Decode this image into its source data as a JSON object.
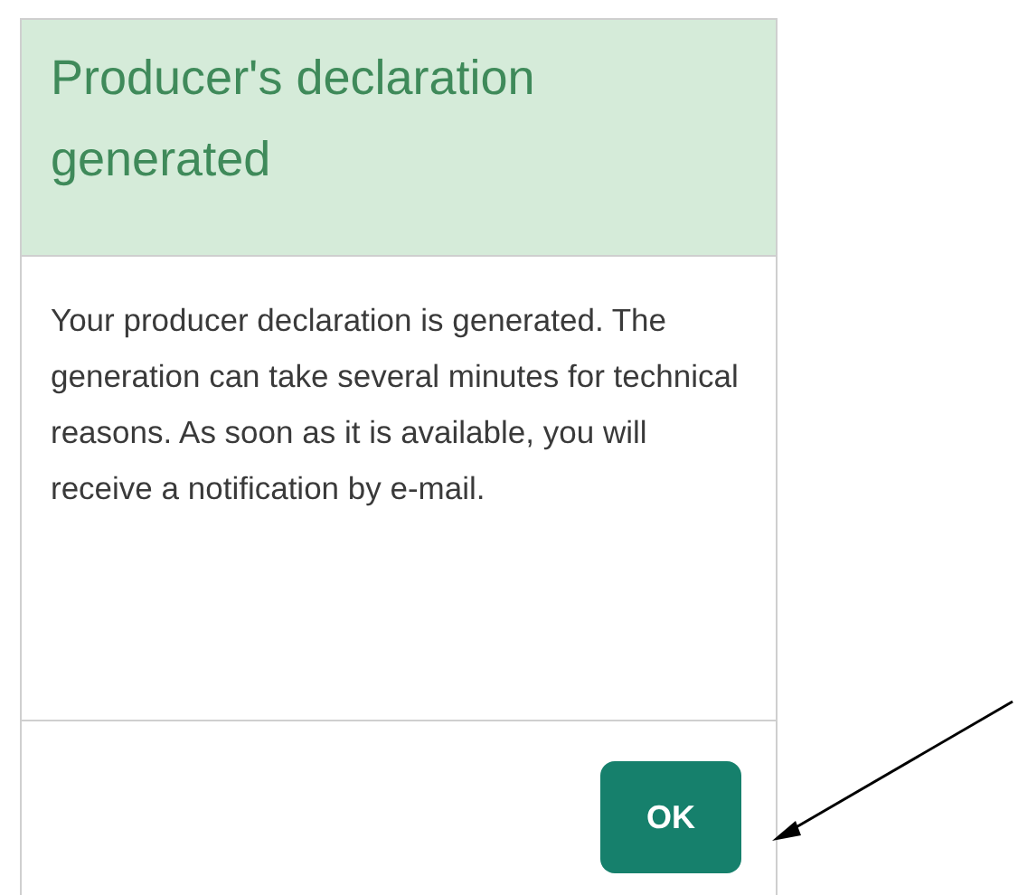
{
  "dialog": {
    "title": "Producer's declaration generated",
    "message": "Your producer declaration is generated. The generation can take several minutes for technical reasons. As soon as it is available, you will receive a notification by e-mail.",
    "buttons": [
      {
        "label": "OK"
      }
    ]
  }
}
